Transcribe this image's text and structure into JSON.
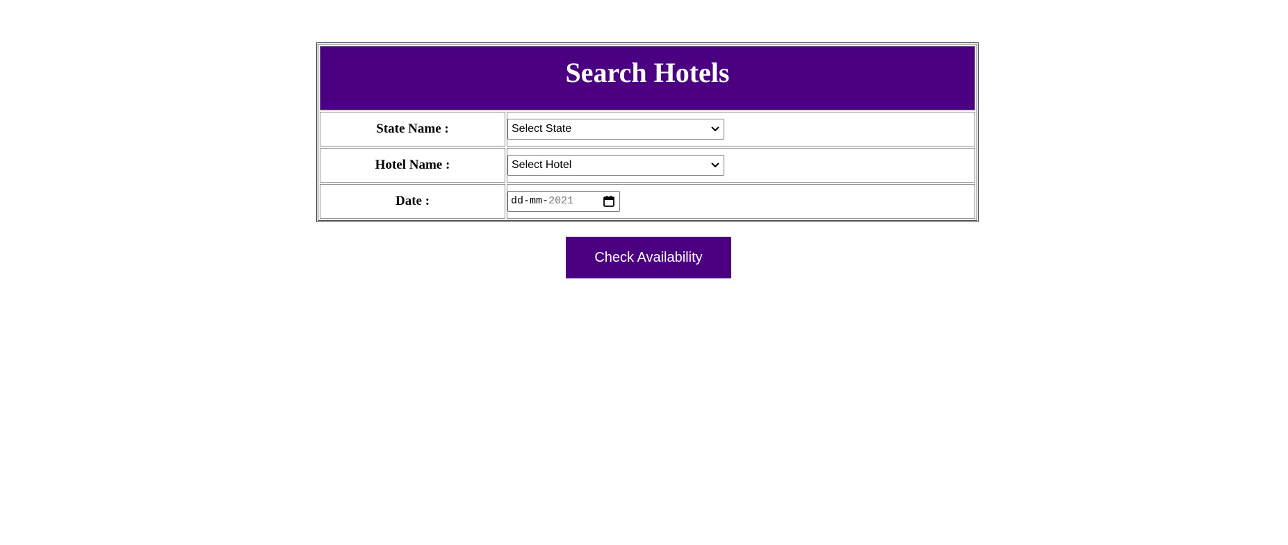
{
  "form": {
    "title": "Search Hotels",
    "state_label": "State Name :",
    "state_selected": "Select State",
    "hotel_label": "Hotel Name :",
    "hotel_selected": "Select Hotel",
    "date_label": "Date :",
    "date_day": "dd",
    "date_month": "mm",
    "date_year": "2021",
    "date_separator": "-",
    "submit_label": "Check Availability"
  },
  "icons": {
    "state_dropdown": "chevron-down-icon",
    "hotel_dropdown": "chevron-down-icon",
    "date_picker": "calendar-icon"
  },
  "colors": {
    "accent": "#4b0082",
    "header_text": "#ffffff",
    "page_background": "#ffffff"
  }
}
